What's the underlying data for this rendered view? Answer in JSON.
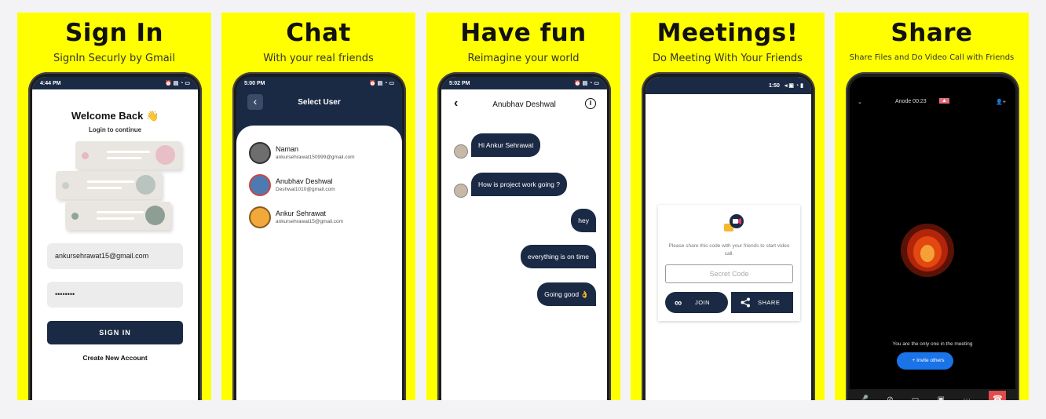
{
  "panels": {
    "signin": {
      "title": "Sign In",
      "subtitle": "SignIn Securly by Gmail"
    },
    "chat": {
      "title": "Chat",
      "subtitle": "With your real friends"
    },
    "fun": {
      "title": "Have fun",
      "subtitle": "Reimagine your world"
    },
    "meet": {
      "title": "Meetings!",
      "subtitle": "Do Meeting With Your Friends"
    },
    "share": {
      "title": "Share",
      "subtitle": "Share Files and Do Video Call with Friends"
    }
  },
  "signin_screen": {
    "status_time": "4:44 PM",
    "welcome": "Welcome Back 👋",
    "subtitle": "Login to continue",
    "email_value": "ankursehrawat15@gmail.com",
    "password_value": "••••••••",
    "button_label": "SIGN IN",
    "create_account": "Create New Account"
  },
  "chat_screen": {
    "status_time": "5:00 PM",
    "back_icon": "‹",
    "title": "Select User",
    "users": [
      {
        "name": "Naman",
        "email": "ankursehrawat150999@gmail.com"
      },
      {
        "name": "Anubhav Deshwal",
        "email": "Deshwal1010@gmail.com"
      },
      {
        "name": "Ankur Sehrawat",
        "email": "ankursehrawat15@gmail.com"
      }
    ]
  },
  "fun_screen": {
    "status_time": "5:02 PM",
    "contact_name": "Anubhav Deshwal",
    "back_icon": "‹",
    "info_icon": "i",
    "messages": [
      {
        "side": "left",
        "text": "Hi Ankur Sehrawat"
      },
      {
        "side": "left",
        "text": "How is project work going ?"
      },
      {
        "side": "right",
        "text": "hey"
      },
      {
        "side": "right",
        "text": "everything is on time"
      },
      {
        "side": "right",
        "text": "Going good 👌"
      }
    ]
  },
  "meet_screen": {
    "status_text": "1:50",
    "info": "Please share this code with your friends to start video call.",
    "code_placeholder": "Secret Code",
    "join_label": "JOIN",
    "share_label": "SHARE"
  },
  "share_screen": {
    "top_text": "Anode 00:23",
    "only_one_text": "You are the only one in the meeting",
    "invite_label": "Invite others"
  },
  "colors": {
    "panel_bg": "#ffff00",
    "navy": "#1b2a44",
    "invite_blue": "#1a73e8",
    "hangup_red": "#e04b4b"
  }
}
